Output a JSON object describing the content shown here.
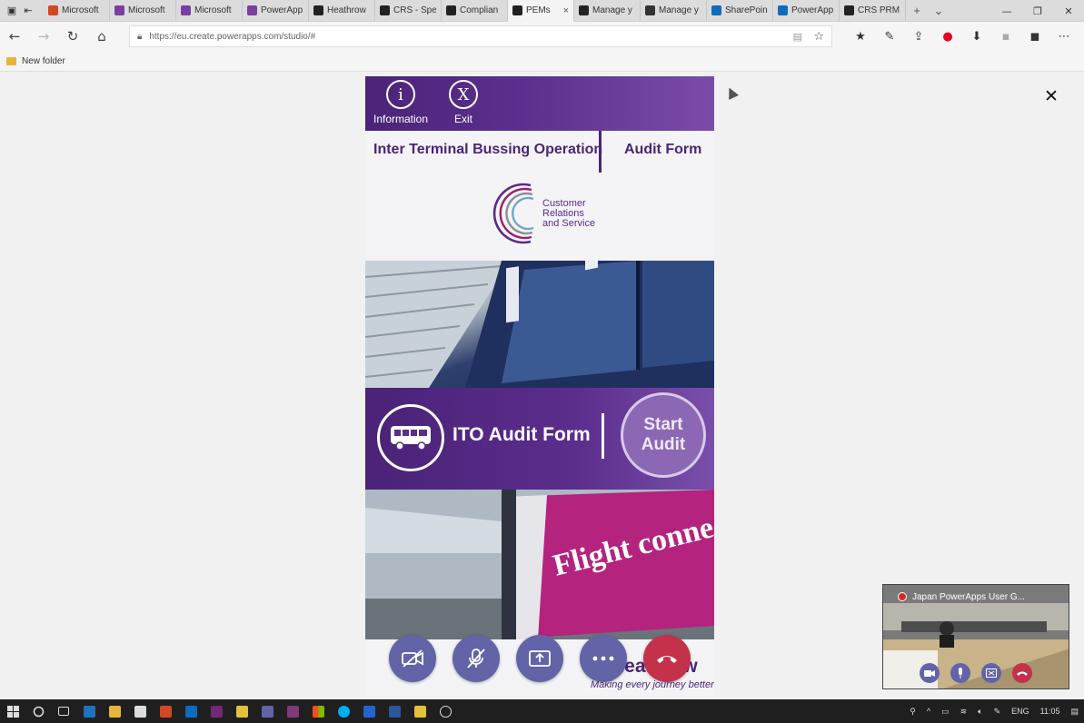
{
  "browser": {
    "tabs": [
      {
        "title": "Microsoft",
        "favicon_color": "#d24726"
      },
      {
        "title": "Microsoft",
        "favicon_color": "#7b3fa0"
      },
      {
        "title": "Microsoft",
        "favicon_color": "#7b3fa0"
      },
      {
        "title": "PowerApp",
        "favicon_color": "#7b3fa0"
      },
      {
        "title": "Heathrow",
        "favicon_color": "#222222"
      },
      {
        "title": "CRS - Spe",
        "favicon_color": "#222222"
      },
      {
        "title": "Complian",
        "favicon_color": "#222222"
      },
      {
        "title": "PEMs",
        "favicon_color": "#222222",
        "active": true
      },
      {
        "title": "Manage y",
        "favicon_color": "#222222"
      },
      {
        "title": "Manage y",
        "favicon_color": "#333333"
      },
      {
        "title": "SharePoin",
        "favicon_color": "#0f6cbd"
      },
      {
        "title": "PowerApp",
        "favicon_color": "#0f6cbd"
      },
      {
        "title": "CRS PRM",
        "favicon_color": "#222222"
      }
    ],
    "tab_close_glyph": "×",
    "new_tab_glyph": "+",
    "tab_list_glyph": "⌄",
    "url": "https://eu.create.powerapps.com/studio/#",
    "favorites": [
      {
        "label": "New folder"
      }
    ]
  },
  "app": {
    "header": {
      "info_icon_glyph": "i",
      "info_label": "Information",
      "exit_icon_glyph": "X",
      "exit_label": "Exit"
    },
    "title_left": "Inter Terminal Bussing Operation",
    "title_right": "Audit Form",
    "logo_text": [
      "Customer",
      "Relations",
      "and Service"
    ],
    "band": {
      "title": "ITO Audit Form",
      "start_button_lines": [
        "Start",
        "Audit"
      ]
    },
    "footer": {
      "brand": "Heathrow",
      "tagline": "Making every journey better"
    },
    "photo2_caption": "Flight connect"
  },
  "meeting": {
    "controls": [
      "camera-off-icon",
      "mic-off-icon",
      "share-screen-icon",
      "more-icon",
      "hang-up-icon"
    ],
    "mini_window_title": "Japan PowerApps User G..."
  },
  "taskbar": {
    "language": "ENG",
    "time": "11:05"
  },
  "colors": {
    "brand_purple": "#4a2578",
    "teams_purple": "#6264a7",
    "hangup_red": "#c4314b"
  }
}
